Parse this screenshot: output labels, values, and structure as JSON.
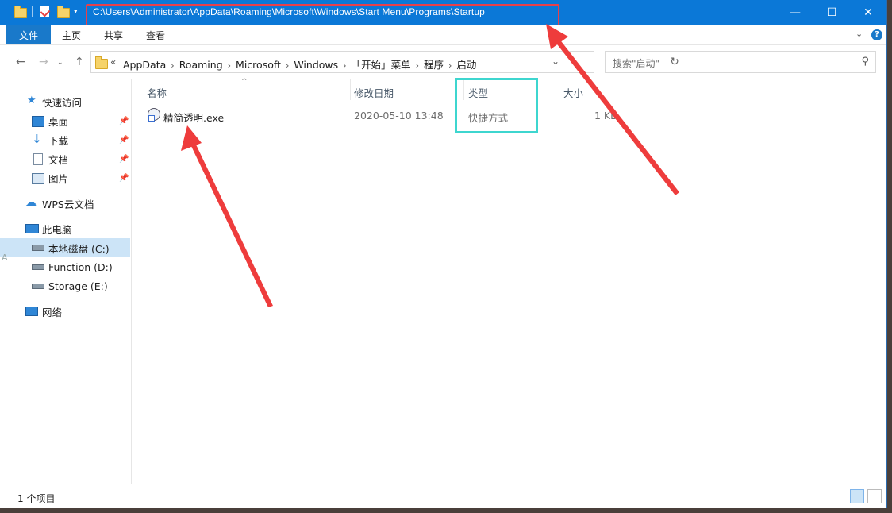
{
  "titlebar": {
    "path": "C:\\Users\\Administrator\\AppData\\Roaming\\Microsoft\\Windows\\Start Menu\\Programs\\Startup",
    "buttons": {
      "minimize": "—",
      "maximize": "☐",
      "close": "✕"
    }
  },
  "ribbon": {
    "tabs": [
      {
        "label": "文件"
      },
      {
        "label": "主页"
      },
      {
        "label": "共享"
      },
      {
        "label": "查看"
      }
    ],
    "help": "?"
  },
  "address": {
    "overflow": "«",
    "crumbs": [
      "AppData",
      "Roaming",
      "Microsoft",
      "Windows",
      "「开始」菜单",
      "程序",
      "启动"
    ]
  },
  "search": {
    "placeholder": "搜索\"启动\""
  },
  "sidebar": {
    "items": [
      {
        "label": "快速访问",
        "icon": "star-icon"
      },
      {
        "label": "桌面",
        "icon": "desktop-icon",
        "pinned": true
      },
      {
        "label": "下载",
        "icon": "download-icon",
        "pinned": true
      },
      {
        "label": "文档",
        "icon": "document-icon",
        "pinned": true
      },
      {
        "label": "图片",
        "icon": "pictures-icon",
        "pinned": true
      },
      {
        "label": "WPS云文档",
        "icon": "cloud-icon"
      },
      {
        "label": "此电脑",
        "icon": "computer-icon"
      },
      {
        "label": "本地磁盘 (C:)",
        "icon": "drive-c-icon",
        "selected": true
      },
      {
        "label": "Function (D:)",
        "icon": "drive-icon"
      },
      {
        "label": "Storage (E:)",
        "icon": "drive-icon"
      },
      {
        "label": "网络",
        "icon": "network-icon"
      }
    ]
  },
  "filelist": {
    "columns": [
      "名称",
      "修改日期",
      "类型",
      "大小"
    ],
    "rows": [
      {
        "name": "精简透明.exe",
        "modified": "2020-05-10 13:48",
        "type": "快捷方式",
        "size": "1 KB"
      }
    ]
  },
  "status": {
    "count": "1 个项目"
  },
  "edge_letter": "A",
  "colors": {
    "titlebar": "#0b78d7",
    "highlight_red": "#e8404a",
    "highlight_cyan": "#3ed6cf",
    "selected": "#cce4f7"
  }
}
